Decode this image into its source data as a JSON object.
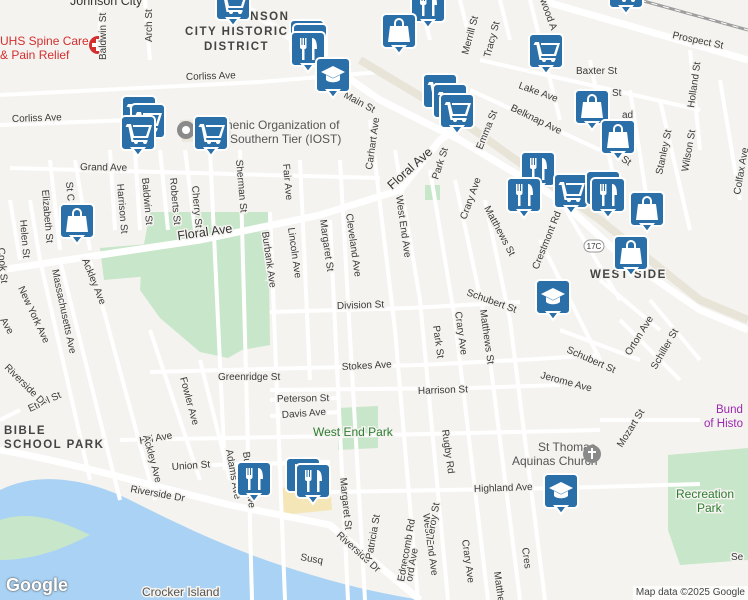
{
  "map": {
    "attribution": "Map data ©2025 Google",
    "logo": "Google",
    "colors": {
      "land": "#f4f3ef",
      "road": "#ffffff",
      "road_edge": "#d9d7d1",
      "river": "#a9d2f4",
      "park": "#c8e6c9",
      "highway": "#c8c6c0",
      "railway": "#9e9e9e",
      "pin": "#2a6fa8"
    },
    "places": {
      "district_line1": "JOHNSON",
      "district_line2": "CITY HISTORIC",
      "district_line3": "DISTRICT",
      "westside": "WEST SIDE",
      "johnson_city": "Johnson City",
      "uhs_line1": "UHS Spine Care",
      "uhs_line2": "& Pain Relief",
      "iost_line1": "Ecumenic Organization of",
      "iost_line2": "Southern Tier (IOST)",
      "west_end_park": "West End Park",
      "recreation_park_1": "Recreation",
      "recreation_park_2": "Park",
      "st_thomas_1": "St Thomas",
      "st_thomas_2": "Aquinas Church",
      "bible_1": "BIBLE",
      "bible_2": "SCHOOL PARK",
      "crocker_island": "Crocker Island",
      "bundy_1": "Bund",
      "bundy_2": "of Histo",
      "route_shield": "17C"
    },
    "streets": {
      "arch": "Arch St",
      "baldwin_n": "Baldwin St",
      "corliss_ave": "Corliss Ave",
      "corliss_ave_w": "Corliss Ave",
      "main_st_n": "Main St",
      "main_st_s": "Main St",
      "floral_ave_w": "Floral Ave",
      "floral_ave_e": "Floral Ave",
      "grand_ave": "Grand Ave",
      "carhart_ave": "Carhart Ave",
      "emma_st": "Emma St",
      "park_st_n": "Park St",
      "park_st_s": "Park St",
      "crary_ave_n": "Crary Ave",
      "crary_ave_m": "Crary Ave",
      "crary_ave_s": "Crary Ave",
      "matthews_st_n": "Matthews St",
      "matthews_st_m": "Matthews St",
      "matthews_st_s": "Matthews St",
      "merrill_st": "Merrill St",
      "tracy_st": "Tracy St",
      "prospect_st": "Prospect St",
      "lake_ave": "Lake Ave",
      "baxter_st": "Baxter St",
      "belknap_ave": "Belknap Ave",
      "holland_st": "Holland St",
      "stanley_st": "Stanley St",
      "wilson_st": "Wilson St",
      "colfax_ave": "Colfax Ave",
      "crestmont_rd": "Crestmont Rd",
      "schubert_st_n": "Schubert St",
      "schubert_st_s": "Schubert St",
      "orton_ave": "Orton Ave",
      "schiller_st": "Schiller St",
      "jerome_ave": "Jerome Ave",
      "mozart_st": "Mozart St",
      "west_end_ave_n": "West End Ave",
      "west_end_ave_s": "West End Ave",
      "division_st": "Division St",
      "stokes_ave": "Stokes Ave",
      "harrison_st_e": "Harrison St",
      "harrison_st_w": "Harrison St",
      "greenridge_st": "Greenridge St",
      "peterson_st": "Peterson St",
      "davis_ave": "Davis Ave",
      "hill_ave": "Hill Ave",
      "union_st": "Union St",
      "ethel_st": "Ethel St",
      "riverside_dr_w": "Riverside Dr",
      "riverside_dr_m": "Riverside Dr",
      "riverside_dr_e": "Riverside Dr",
      "highland_ave": "Highland Ave",
      "rugby_rd": "Rugby Rd",
      "leroy_st": "Leroy St",
      "edgecomb_rd": "Edgecomb Rd",
      "patricia_st": "Patricia St",
      "margaret_st_n": "Margaret St",
      "margaret_st_s": "Margaret St",
      "cleveland_ave": "Cleveland Ave",
      "lincoln_ave": "Lincoln Ave",
      "burbank_ave_n": "Burbank Ave",
      "burbank_ave_s": "Burbank Ave",
      "fair_ave": "Fair Ave",
      "sherman_st": "Sherman St",
      "cherry_st": "Cherry St",
      "roberts_st": "Roberts St",
      "baldwin_st": "Baldwin St",
      "harrison_st_v": "Harrison St",
      "st_c": "St C",
      "elizabeth_st": "Elizabeth St",
      "helen_st": "Helen St",
      "cook_st": "Cook St",
      "ave_left": "Ave",
      "new_york_ave": "New York Ave",
      "massachusetts_ave": "Massachusetts Ave",
      "ackley_ave_n": "Ackley Ave",
      "ackley_ave_s": "Ackley Ave",
      "fowler_ave": "Fowler Ave",
      "adams_ave": "Adams Ave",
      "mcl_ave": "Ave",
      "ord_ave": "ord Ave",
      "ave_sw": "Ave",
      "ad_frag": "ad",
      "son_st": "son St",
      "st_frag": "St",
      "cres_frag": "Cres",
      "mat_frag": "Mat",
      "se_frag": "Se",
      "wood_frag": "wood A",
      "susq_frag": "Susq"
    },
    "pins": [
      {
        "type": "shopping-cart",
        "label": "shopping"
      },
      {
        "type": "shopping-bag",
        "label": "store"
      },
      {
        "type": "restaurant",
        "label": "restaurant"
      },
      {
        "type": "school",
        "label": "school"
      }
    ]
  }
}
